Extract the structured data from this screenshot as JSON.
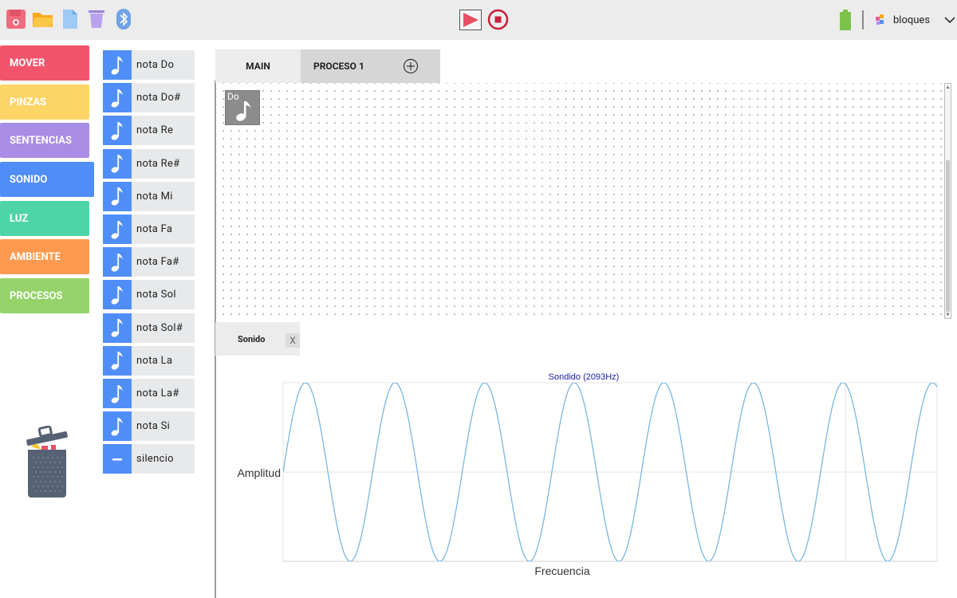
{
  "toolbar": {
    "icons": [
      "save-icon",
      "folder-open-icon",
      "new-file-icon",
      "trash-icon",
      "bluetooth-icon",
      "play-icon",
      "stop-icon",
      "battery-icon",
      "blocks-icon",
      "chevron-down-icon"
    ],
    "mode_label": "bloques"
  },
  "categories": [
    {
      "label": "MOVER",
      "color": "#f2556b"
    },
    {
      "label": "PINZAS",
      "color": "#fdd567"
    },
    {
      "label": "SENTENCIAS",
      "color": "#a98ce6"
    },
    {
      "label": "SONIDO",
      "color": "#4f8ef7"
    },
    {
      "label": "LUZ",
      "color": "#4fd4a8"
    },
    {
      "label": "AMBIENTE",
      "color": "#fd9a4f"
    },
    {
      "label": "PROCESOS",
      "color": "#95d36a"
    }
  ],
  "palette": [
    {
      "label": "nota Do"
    },
    {
      "label": "nota Do#"
    },
    {
      "label": "nota Re"
    },
    {
      "label": "nota Re#"
    },
    {
      "label": "nota Mi"
    },
    {
      "label": "nota Fa"
    },
    {
      "label": "nota Fa#"
    },
    {
      "label": "nota Sol"
    },
    {
      "label": "nota Sol#"
    },
    {
      "label": "nota La"
    },
    {
      "label": "nota La#"
    },
    {
      "label": "nota Si"
    },
    {
      "label": "silencio"
    }
  ],
  "tabs": [
    {
      "label": "MAIN"
    },
    {
      "label": "PROCESO 1"
    }
  ],
  "workspace": {
    "block_label": "Do"
  },
  "sound_panel": {
    "tab_label": "Sonido",
    "close_label": "X"
  },
  "chart_data": {
    "type": "line",
    "title": "Sondido (2093Hz)",
    "xlabel": "Frecuencia",
    "ylabel": "Amplitud",
    "grid": true,
    "series_color": "#7ab7e2",
    "title_color": "#1a1aa6",
    "cycles_shown": 7.3,
    "phase_start": 0.0,
    "amplitude": 1.0
  }
}
